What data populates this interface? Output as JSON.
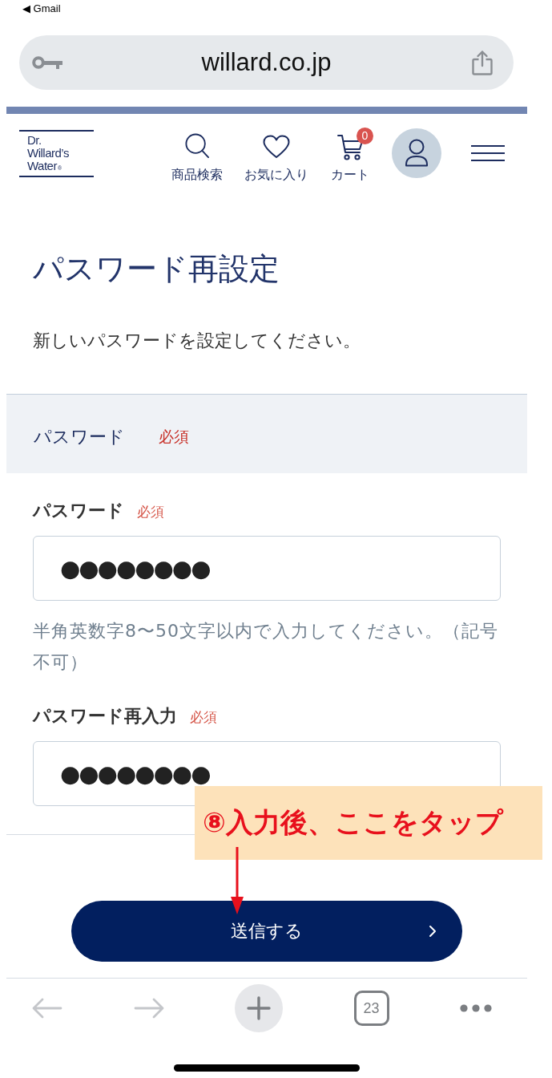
{
  "status_bar": {
    "back_label": "◀ Gmail"
  },
  "address_bar": {
    "url": "willard.co.jp"
  },
  "header": {
    "logo": {
      "lines": [
        "Dr.",
        "Willard’s",
        "Water"
      ],
      "mark": "®"
    },
    "nav": [
      {
        "kind": "search",
        "label": "商品検索"
      },
      {
        "kind": "favorite",
        "label": "お気に入り"
      },
      {
        "kind": "cart",
        "label": "カート",
        "badge": "0"
      }
    ]
  },
  "page": {
    "title": "パスワード再設定",
    "intro": "新しいパスワードを設定してください。",
    "section": {
      "label": "パスワード",
      "badge": "必須"
    },
    "fields": [
      {
        "label": "パスワード",
        "badge": "必須",
        "value": "●●●●●●●●",
        "hint": "半角英数字8〜50文字以内で入力してください。（記号不可）"
      },
      {
        "label": "パスワード再入力",
        "badge": "必須",
        "value": "●●●●●●●●"
      }
    ],
    "submit": {
      "label": "送信する"
    }
  },
  "annotation": {
    "text": "⑧入力後、ここをタップ"
  },
  "toolbar": [
    {
      "kind": "back",
      "disabled": true
    },
    {
      "kind": "forward",
      "disabled": true
    },
    {
      "kind": "new_tab",
      "disabled": false
    },
    {
      "kind": "tabs",
      "label": "23",
      "disabled": false
    },
    {
      "kind": "more",
      "disabled": false
    }
  ]
}
